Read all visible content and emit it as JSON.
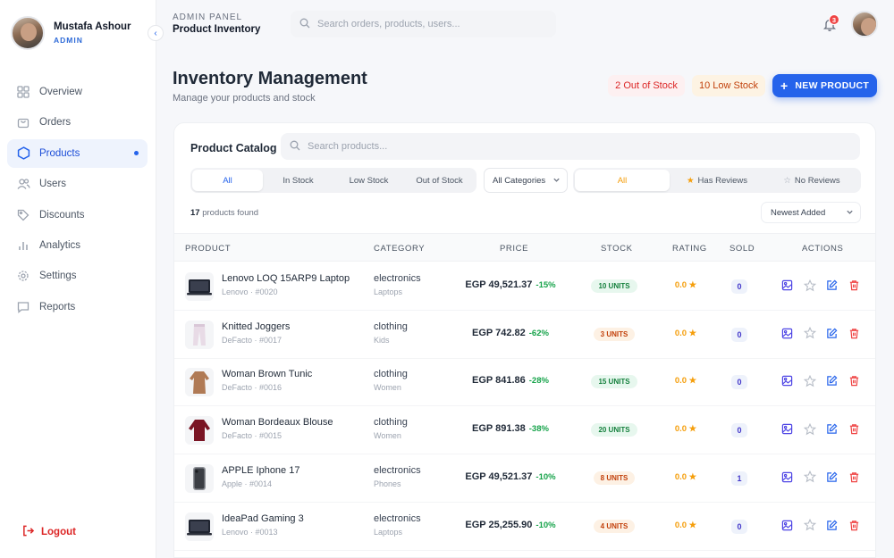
{
  "sidebar": {
    "profile": {
      "name": "Mustafa Ashour",
      "role": "ADMIN"
    },
    "collapse_icon": "chevron-left-icon",
    "items": [
      {
        "label": "Overview",
        "icon": "grid-icon"
      },
      {
        "label": "Orders",
        "icon": "bag-icon"
      },
      {
        "label": "Products",
        "icon": "hexagon-icon",
        "active": true
      },
      {
        "label": "Users",
        "icon": "users-icon"
      },
      {
        "label": "Discounts",
        "icon": "tag-icon"
      },
      {
        "label": "Analytics",
        "icon": "bar-chart-icon"
      },
      {
        "label": "Settings",
        "icon": "gear-icon"
      },
      {
        "label": "Reports",
        "icon": "message-icon"
      }
    ],
    "logout_label": "Logout"
  },
  "header": {
    "section_label": "ADMIN PANEL",
    "page_label": "Product Inventory",
    "search_placeholder": "Search orders, products, users...",
    "notification_count": "3"
  },
  "page": {
    "title": "Inventory Management",
    "subtitle": "Manage your products and stock",
    "out_of_stock_badge": "2 Out of Stock",
    "low_stock_badge": "10 Low Stock",
    "new_product_label": "NEW PRODUCT"
  },
  "catalog": {
    "title": "Product Catalog",
    "search_placeholder": "Search products...",
    "stock_filters": [
      "All",
      "In Stock",
      "Low Stock",
      "Out of Stock"
    ],
    "category_select": "All Categories",
    "review_filters": [
      "All",
      "Has Reviews",
      "No Reviews"
    ],
    "count": "17",
    "count_suffix": "products found",
    "sort_select": "Newest Added",
    "columns": [
      "PRODUCT",
      "CATEGORY",
      "PRICE",
      "STOCK",
      "RATING",
      "SOLD",
      "ACTIONS"
    ],
    "rows": [
      {
        "name": "Lenovo LOQ 15ARP9 Laptop",
        "meta": "Lenovo · #0020",
        "category": "electronics",
        "subcategory": "Laptops",
        "price": "EGP 49,521.37",
        "discount": "-15%",
        "stock": "10 UNITS",
        "stock_status": "good",
        "rating": "0.0 ★",
        "sold": "0",
        "thumb": "laptop-thumbnail"
      },
      {
        "name": "Knitted Joggers",
        "meta": "DeFacto · #0017",
        "category": "clothing",
        "subcategory": "Kids",
        "price": "EGP 742.82",
        "discount": "-62%",
        "stock": "3 UNITS",
        "stock_status": "low",
        "rating": "0.0 ★",
        "sold": "0",
        "thumb": "joggers-thumbnail"
      },
      {
        "name": "Woman Brown Tunic",
        "meta": "DeFacto · #0016",
        "category": "clothing",
        "subcategory": "Women",
        "price": "EGP 841.86",
        "discount": "-28%",
        "stock": "15 UNITS",
        "stock_status": "good",
        "rating": "0.0 ★",
        "sold": "0",
        "thumb": "tunic-thumbnail"
      },
      {
        "name": "Woman Bordeaux Blouse",
        "meta": "DeFacto · #0015",
        "category": "clothing",
        "subcategory": "Women",
        "price": "EGP 891.38",
        "discount": "-38%",
        "stock": "20 UNITS",
        "stock_status": "good",
        "rating": "0.0 ★",
        "sold": "0",
        "thumb": "blouse-thumbnail"
      },
      {
        "name": "APPLE Iphone 17",
        "meta": "Apple · #0014",
        "category": "electronics",
        "subcategory": "Phones",
        "price": "EGP 49,521.37",
        "discount": "-10%",
        "stock": "8 UNITS",
        "stock_status": "low",
        "rating": "0.0 ★",
        "sold": "1",
        "thumb": "phone-thumbnail"
      },
      {
        "name": "IdeaPad Gaming 3",
        "meta": "Lenovo · #0013",
        "category": "electronics",
        "subcategory": "Laptops",
        "price": "EGP 25,255.90",
        "discount": "-10%",
        "stock": "4 UNITS",
        "stock_status": "low",
        "rating": "0.0 ★",
        "sold": "0",
        "thumb": "laptop-thumbnail"
      }
    ],
    "row_actions": [
      "image-icon",
      "star-icon",
      "edit-icon",
      "trash-icon"
    ]
  },
  "colors": {
    "accent": "#2563eb",
    "danger": "#dc2626",
    "warning": "#f59e0b",
    "success": "#16a34a"
  }
}
